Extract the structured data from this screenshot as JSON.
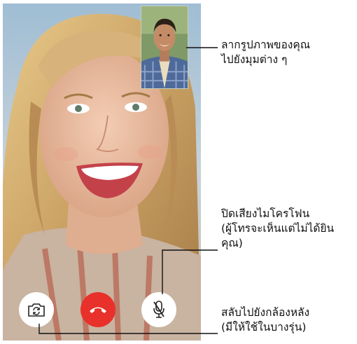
{
  "screen": {
    "type": "facetime-call",
    "pip_label": "ภาพของคุณ"
  },
  "controls": {
    "flip_camera": {
      "icon": "camera-flip-icon"
    },
    "end_call": {
      "icon": "phone-hangup-icon",
      "color": "#e8312a"
    },
    "mute": {
      "icon": "microphone-mute-icon"
    }
  },
  "callouts": {
    "pip": [
      "ลากรูปภาพของคุณ",
      "ไปยังมุมต่าง ๆ"
    ],
    "mute": [
      "ปิดเสียงไมโครโฟน",
      "(ผู้โทรจะเห็นแต่ไม่ได้ยิน",
      "คุณ)"
    ],
    "flip": [
      "สลับไปยังกล้องหลัง",
      "(มีให้ใช้ในบางรุ่น)"
    ]
  }
}
